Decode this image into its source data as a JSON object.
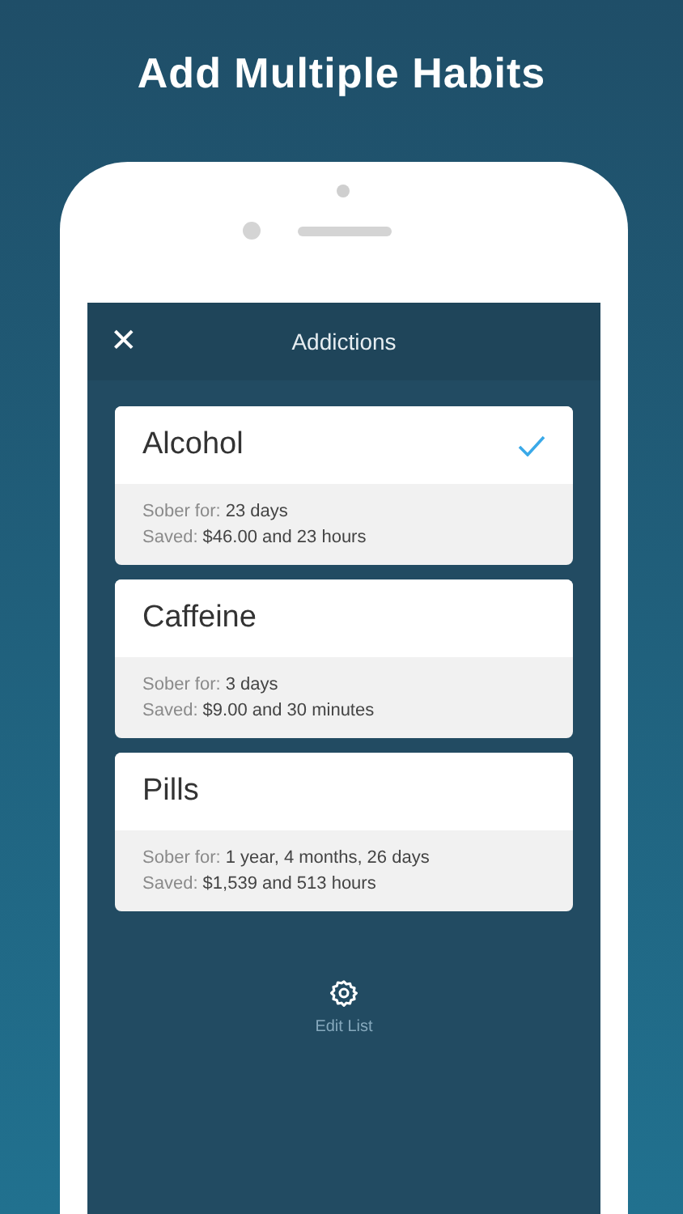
{
  "headline": "Add Multiple Habits",
  "nav": {
    "close": "✕",
    "title": "Addictions"
  },
  "addictions": [
    {
      "name": "Alcohol",
      "selected": true,
      "sober_label": "Sober for:",
      "sober_value": "23 days",
      "saved_label": "Saved:",
      "saved_value": "$46.00 and 23 hours"
    },
    {
      "name": "Caffeine",
      "selected": false,
      "sober_label": "Sober for:",
      "sober_value": "3 days",
      "saved_label": "Saved:",
      "saved_value": "$9.00 and 30 minutes"
    },
    {
      "name": "Pills",
      "selected": false,
      "sober_label": "Sober for:",
      "sober_value": "1 year, 4 months, 26 days",
      "saved_label": "Saved:",
      "saved_value": "$1,539 and 513 hours"
    }
  ],
  "edit_button": "Edit List"
}
